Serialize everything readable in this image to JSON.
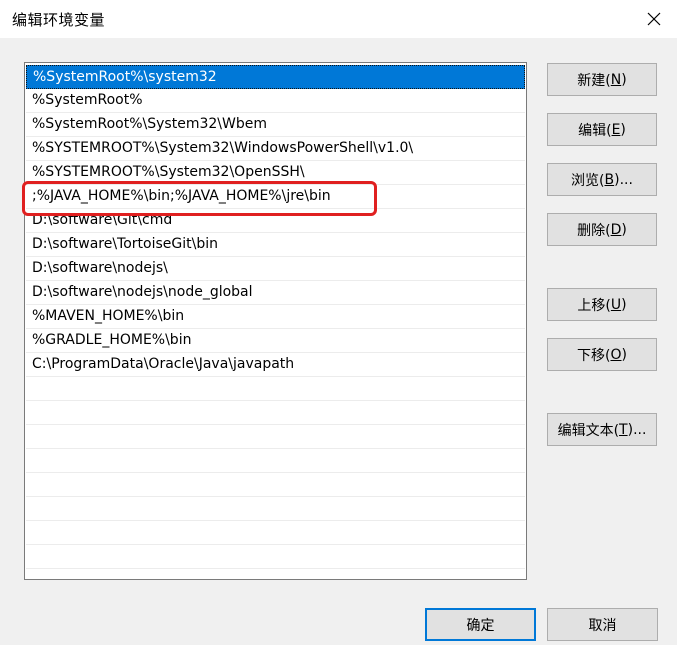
{
  "window": {
    "title": "编辑环境变量"
  },
  "list": {
    "items": [
      "%SystemRoot%\\system32",
      "%SystemRoot%",
      "%SystemRoot%\\System32\\Wbem",
      "%SYSTEMROOT%\\System32\\WindowsPowerShell\\v1.0\\",
      "%SYSTEMROOT%\\System32\\OpenSSH\\",
      ";%JAVA_HOME%\\bin;%JAVA_HOME%\\jre\\bin",
      "D:\\software\\Git\\cmd",
      "D:\\software\\TortoiseGit\\bin",
      "D:\\software\\nodejs\\",
      "D:\\software\\nodejs\\node_global",
      "%MAVEN_HOME%\\bin",
      "%GRADLE_HOME%\\bin",
      "C:\\ProgramData\\Oracle\\Java\\javapath"
    ],
    "selected_index": 0
  },
  "buttons": {
    "new": {
      "pre": "新建(",
      "key": "N",
      "post": ")"
    },
    "edit": {
      "pre": "编辑(",
      "key": "E",
      "post": ")"
    },
    "browse": {
      "pre": "浏览(",
      "key": "B",
      "post": ")..."
    },
    "delete": {
      "pre": "删除(",
      "key": "D",
      "post": ")"
    },
    "move_up": {
      "pre": "上移(",
      "key": "U",
      "post": ")"
    },
    "move_down": {
      "pre": "下移(",
      "key": "O",
      "post": ")"
    },
    "edit_text": {
      "pre": "编辑文本(",
      "key": "T",
      "post": ")..."
    },
    "ok": "确定",
    "cancel": "取消"
  },
  "colors": {
    "selection": "#0078d7",
    "highlight_box": "#e02020",
    "default_button_border": "#0078d7"
  },
  "icons": {
    "close": "close-icon"
  }
}
